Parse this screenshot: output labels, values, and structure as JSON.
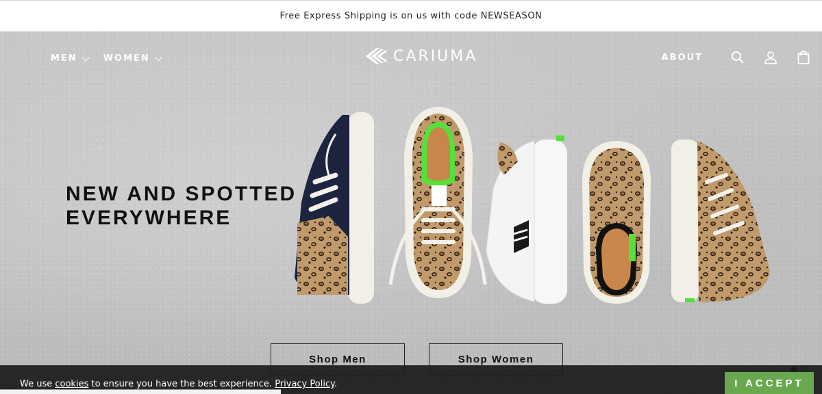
{
  "announcement": {
    "text": "Free Express Shipping is on us with code NEWSEASON"
  },
  "nav": {
    "left": [
      {
        "label": "MEN"
      },
      {
        "label": "WOMEN"
      }
    ],
    "brand": "CARIUMA",
    "right": {
      "about": "ABOUT"
    },
    "icons": [
      "search-icon",
      "account-icon",
      "bag-icon"
    ]
  },
  "hero": {
    "headline_line1": "NEW AND SPOTTED",
    "headline_line2": "EVERYWHERE",
    "cta_men": "Shop Men",
    "cta_women": "Shop Women",
    "slides": 2,
    "active_slide": 1
  },
  "cookie": {
    "prefix": "We use ",
    "cookies_link": "cookies",
    "middle": " to ensure you have the best experience. ",
    "policy_link": "Privacy Policy",
    "suffix": ".",
    "accept": "I ACCEPT"
  },
  "colors": {
    "accent_green": "#6aa84f",
    "sneaker_accent": "#55e03a",
    "navy": "#1c2440",
    "leopard": "#b48a57"
  }
}
